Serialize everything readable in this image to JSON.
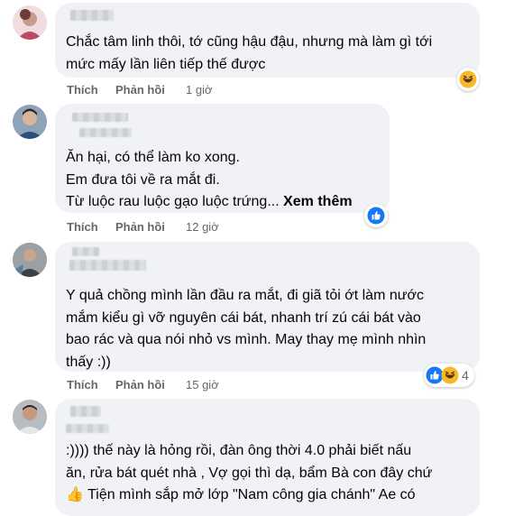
{
  "comments": [
    {
      "lines": "Chắc tâm linh thôi, tớ cũng hậu đậu, nhưng mà làm gì tới\nmức mấy lần liên tiếp thế được",
      "like": "Thích",
      "reply": "Phản hồi",
      "time": "1 giờ",
      "reaction": "haha-icon"
    },
    {
      "lines": "Ăn hại, có thể làm ko xong.\nEm đưa tôi về ra mắt đi.\nTừ luộc rau luộc gạo luộc trứng...",
      "see_more": "Xem thêm",
      "like": "Thích",
      "reply": "Phản hồi",
      "time": "12 giờ",
      "reaction": "like-icon"
    },
    {
      "lines": "Y quả chồng mình lần đầu ra mắt, đi giã tỏi ớt làm nước\nmắm kiểu gì vỡ nguyên cái bát, nhanh trí zú cái bát vào\nbao rác và qua nói nhỏ vs mình. May thay mẹ mình nhìn\nthấy :))",
      "like": "Thích",
      "reply": "Phản hồi",
      "time": "15 giờ",
      "reaction_count": "4"
    },
    {
      "lines": ":)))) thế này là hỏng rồi, đàn ông thời 4.0 phải biết nấu\năn, rửa bát quét nhà , Vợ gọi thì dạ, bẩm Bà con đây chứ\n👍 Tiện mình sắp mở lớp \"Nam công gia chánh\" Ae có"
    }
  ],
  "colors": {
    "bubble": "#f0f2f5",
    "meta": "#65676b",
    "like_blue": "#1877f2",
    "haha_yellow": "#f7b928"
  }
}
